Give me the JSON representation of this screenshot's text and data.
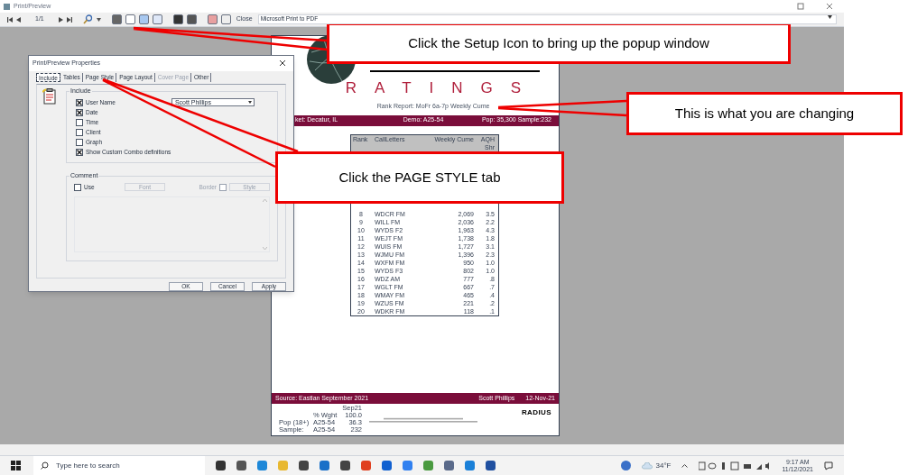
{
  "window": {
    "title": "Print/Preview"
  },
  "toolbar": {
    "page": "1/1",
    "close_button": "Close",
    "printer": "Microsoft Print to PDF"
  },
  "report": {
    "title": "RATINGS",
    "subtitle": "Rank Report:  MoFr 6a-7p   Weekly Cume",
    "market": "ket: Decatur, IL",
    "demo": "Demo: A25-54",
    "pop": "Pop: 35,300  Sample:232",
    "columns": [
      "Rank",
      "CallLetters",
      "Weekly Cume",
      "AQH Shr"
    ],
    "rows": [
      {
        "rank": "8",
        "station": "WDCR FM",
        "cume": "2,069",
        "share": "3.5"
      },
      {
        "rank": "9",
        "station": "WILL FM",
        "cume": "2,036",
        "share": "2.2"
      },
      {
        "rank": "10",
        "station": "WYDS F2",
        "cume": "1,963",
        "share": "4.3"
      },
      {
        "rank": "11",
        "station": "WEJT FM",
        "cume": "1,738",
        "share": "1.8"
      },
      {
        "rank": "12",
        "station": "WUIS FM",
        "cume": "1,727",
        "share": "3.1"
      },
      {
        "rank": "13",
        "station": "WJMU FM",
        "cume": "1,396",
        "share": "2.3"
      },
      {
        "rank": "14",
        "station": "WXFM FM",
        "cume": "950",
        "share": "1.0"
      },
      {
        "rank": "15",
        "station": "WYDS F3",
        "cume": "802",
        "share": "1.0"
      },
      {
        "rank": "16",
        "station": "WDZ  AM",
        "cume": "777",
        "share": ".8"
      },
      {
        "rank": "17",
        "station": "WGLT FM",
        "cume": "667",
        "share": ".7"
      },
      {
        "rank": "18",
        "station": "WMAY FM",
        "cume": "465",
        "share": ".4"
      },
      {
        "rank": "19",
        "station": "WZUS FM",
        "cume": "221",
        "share": ".2"
      },
      {
        "rank": "20",
        "station": "WDKR FM",
        "cume": "118",
        "share": ".1"
      }
    ],
    "source": "Source: Eastlan September 2021",
    "user": "Scott Phillips",
    "date": "12-Nov-21",
    "stats": [
      {
        "value": "Sep21"
      },
      {
        "demo": "% Wght",
        "value": "100.0"
      },
      {
        "label": "Pop (18+)",
        "demo": "A25-54",
        "value": "36.3"
      },
      {
        "label": "Sample:",
        "demo": "A25-54",
        "value": "232"
      }
    ],
    "logo": "RADIUS"
  },
  "dialog": {
    "title": "Print/Preview Properties",
    "tabs": [
      {
        "label": "Include",
        "selected": true,
        "disabled": false
      },
      {
        "label": "Tables",
        "selected": false,
        "disabled": false
      },
      {
        "label": "Page Style",
        "selected": false,
        "disabled": false
      },
      {
        "label": "Page Layout",
        "selected": false,
        "disabled": false
      },
      {
        "label": "Cover Page",
        "selected": false,
        "disabled": true
      },
      {
        "label": "Other",
        "selected": false,
        "disabled": false
      }
    ],
    "include_group": "Include",
    "include_options": [
      {
        "label": "User Name",
        "checked": true
      },
      {
        "label": "Date",
        "checked": true
      },
      {
        "label": "Time",
        "checked": false
      },
      {
        "label": "Client",
        "checked": false
      },
      {
        "label": "Graph",
        "checked": false
      },
      {
        "label": "Show Custom Combo definitions",
        "checked": true
      }
    ],
    "user_name_value": "Scott Phillips",
    "comment_group": "Comment",
    "use_label": "Use",
    "use_checked": false,
    "font_button": "Font",
    "border_label": "Border",
    "border_checked": false,
    "style_button": "Style",
    "buttons": [
      "OK",
      "Cancel",
      "Apply"
    ]
  },
  "callouts": [
    {
      "text": "Click the Setup Icon to bring up the popup window"
    },
    {
      "text": "This is what you are changing"
    },
    {
      "text": "Click the PAGE STYLE tab"
    }
  ],
  "taskbar": {
    "search_placeholder": "Type here to search",
    "temperature": "34°F",
    "time": "9:17 AM",
    "date": "11/12/2021"
  }
}
